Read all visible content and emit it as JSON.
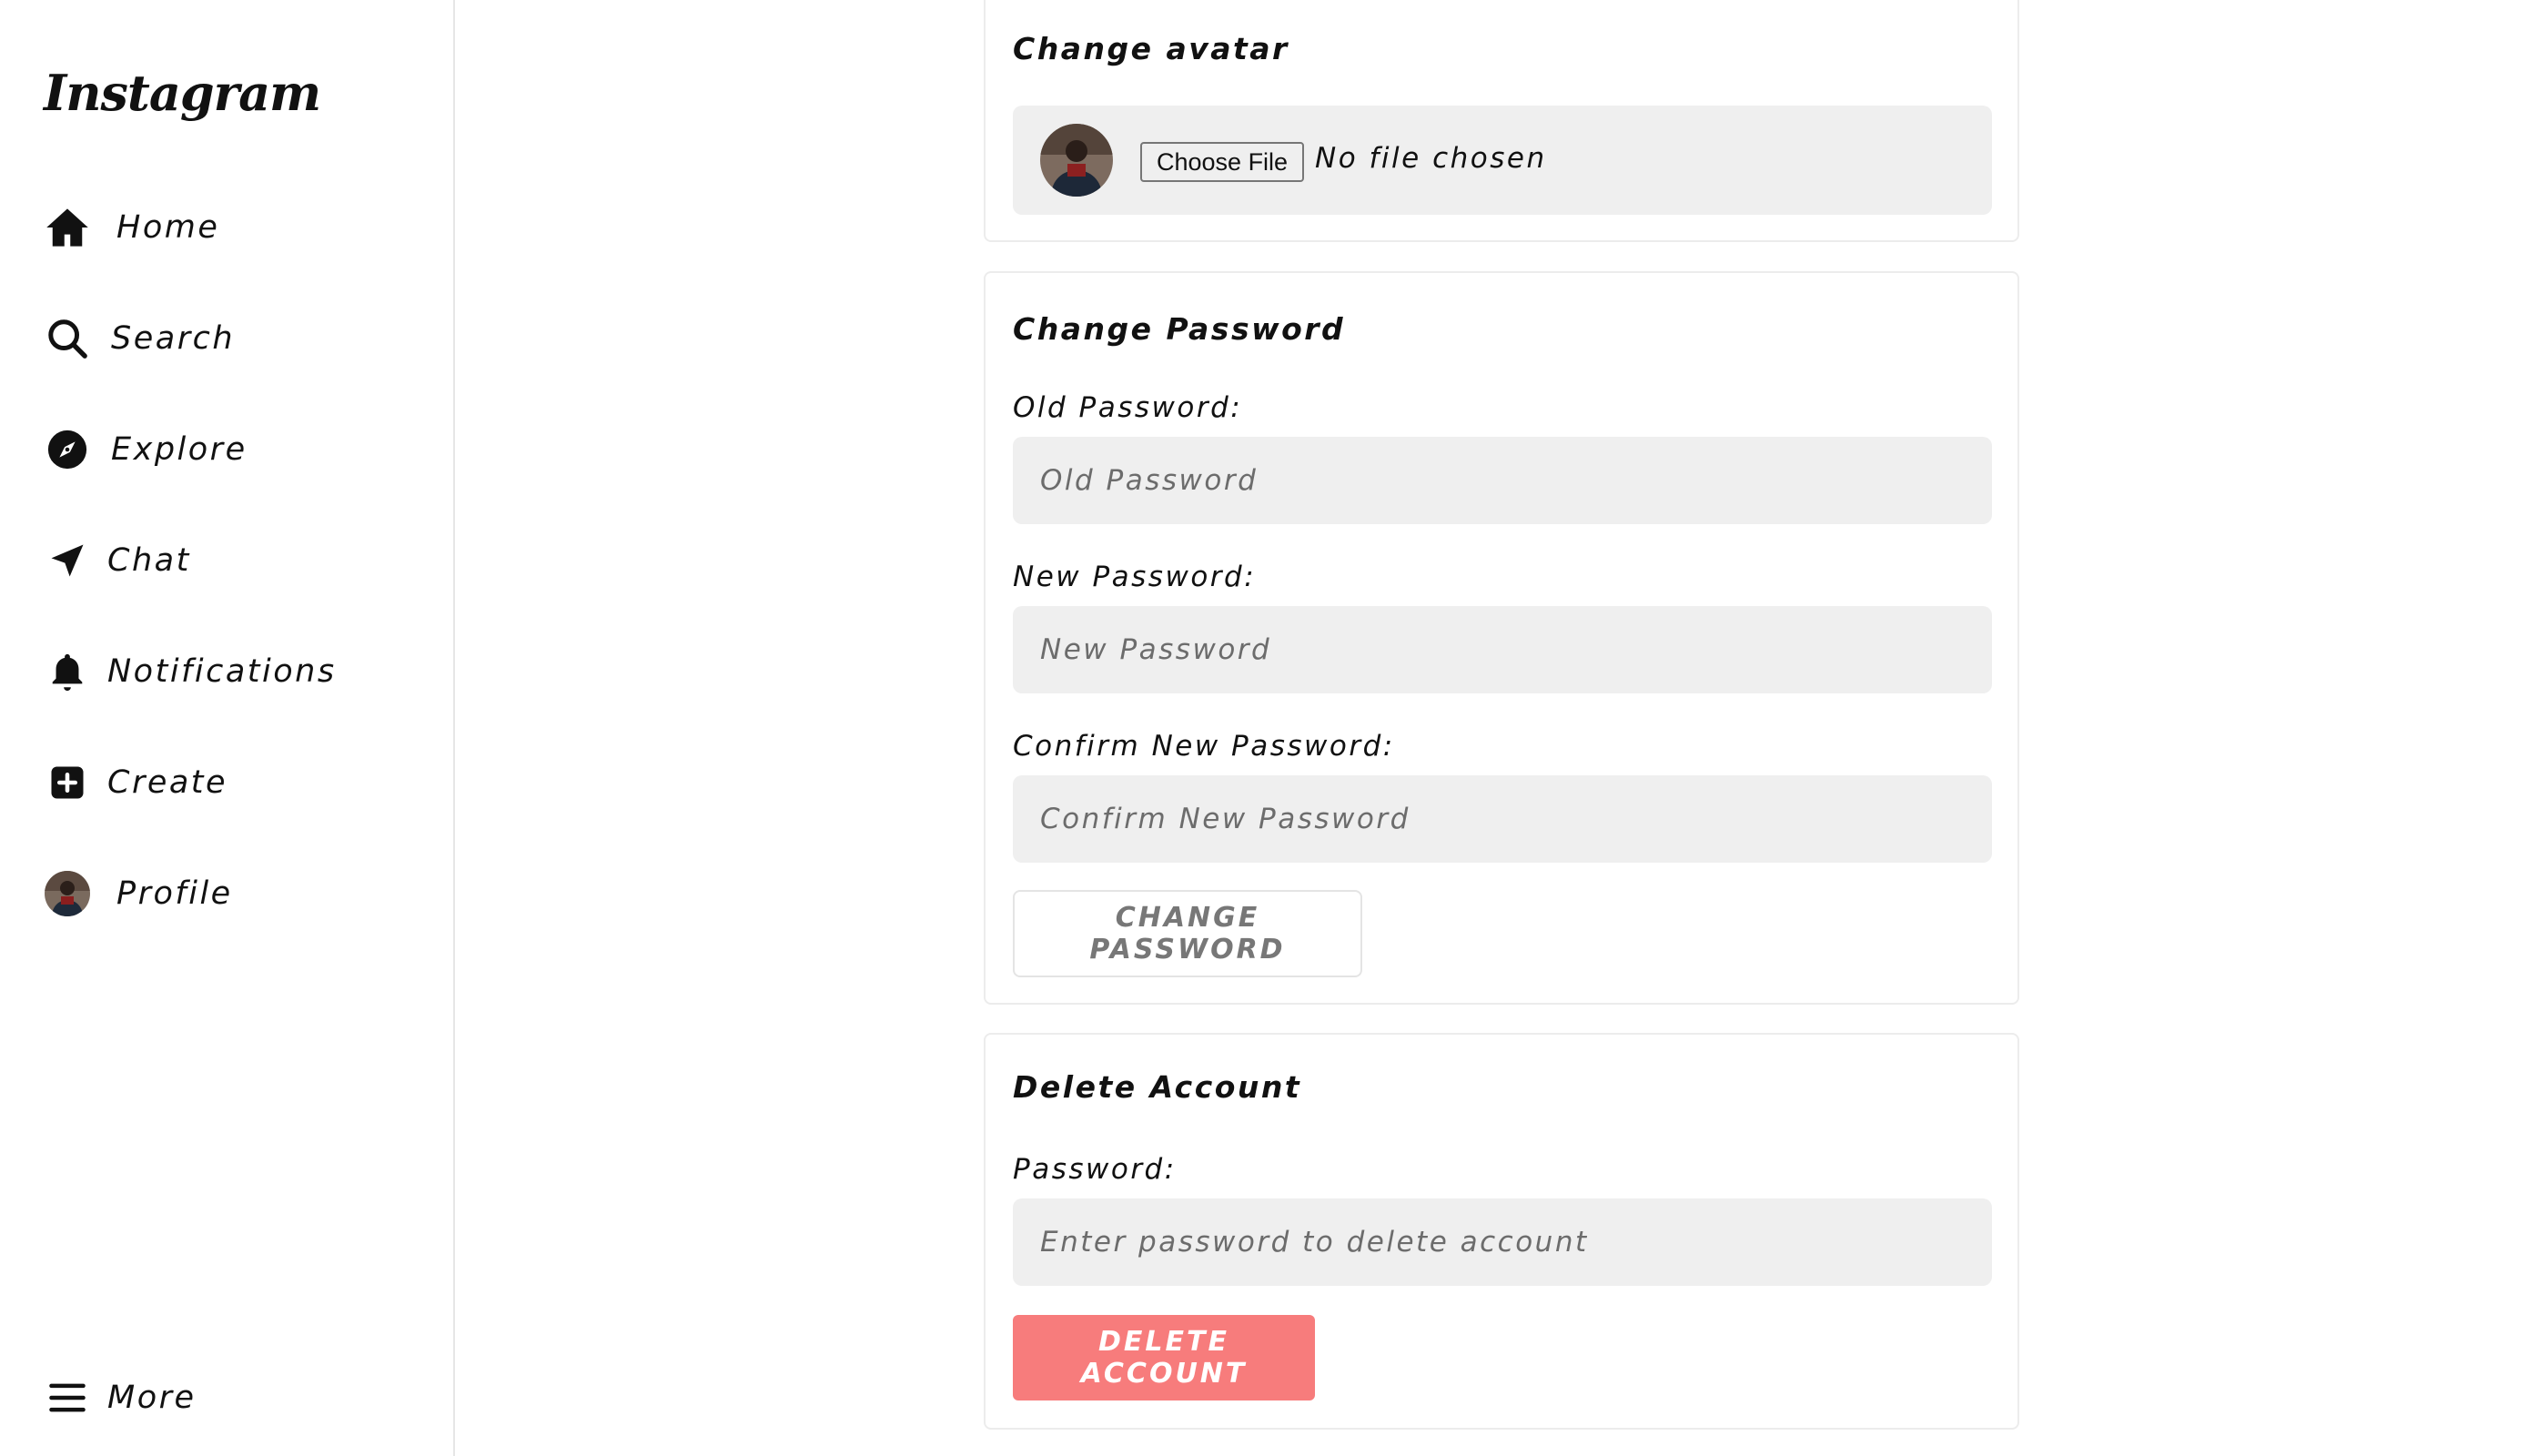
{
  "app": {
    "logo_text": "Instagram"
  },
  "sidebar": {
    "items": [
      {
        "label": "Home",
        "icon": "home-icon"
      },
      {
        "label": "Search",
        "icon": "search-icon"
      },
      {
        "label": "Explore",
        "icon": "compass-icon"
      },
      {
        "label": "Chat",
        "icon": "send-icon"
      },
      {
        "label": "Notifications",
        "icon": "bell-icon"
      },
      {
        "label": "Create",
        "icon": "plus-square-icon"
      },
      {
        "label": "Profile",
        "icon": "avatar"
      }
    ],
    "more": {
      "label": "More",
      "icon": "hamburger-menu-icon"
    }
  },
  "avatar_card": {
    "title": "Change avatar",
    "choose_file_label": "Choose File",
    "file_status": "No file chosen"
  },
  "password_card": {
    "title": "Change Password",
    "old_label": "Old Password:",
    "old_placeholder": "Old Password",
    "new_label": "New Password:",
    "new_placeholder": "New Password",
    "confirm_label": "Confirm New Password:",
    "confirm_placeholder": "Confirm New Password",
    "submit_label": "CHANGE PASSWORD"
  },
  "delete_card": {
    "title": "Delete Account",
    "password_label": "Password:",
    "password_placeholder": "Enter password to delete account",
    "submit_label": "DELETE ACCOUNT"
  },
  "colors": {
    "danger": "#f77c7c",
    "input_bg": "#efefef",
    "border": "#ececec"
  }
}
